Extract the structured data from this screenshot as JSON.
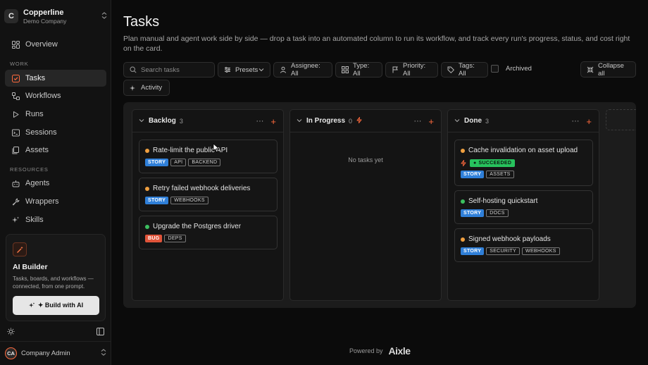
{
  "org": {
    "initial": "C",
    "name": "Copperline",
    "subtitle": "Demo Company"
  },
  "nav": {
    "overview": "Overview",
    "section_work": "WORK",
    "tasks": "Tasks",
    "workflows": "Workflows",
    "runs": "Runs",
    "sessions": "Sessions",
    "assets": "Assets",
    "section_resources": "RESOURCES",
    "agents": "Agents",
    "wrappers": "Wrappers",
    "skills": "Skills"
  },
  "ai_builder": {
    "title": "AI Builder",
    "description": "Tasks, boards, and workflows — connected, from one prompt.",
    "button": "✦ Build with AI"
  },
  "user": {
    "initials": "CA",
    "name": "Company Admin"
  },
  "page": {
    "title": "Tasks",
    "description": "Plan manual and agent work side by side — drop a task into an automated column to run its workflow, and track every run's progress, status, and cost right on the card."
  },
  "toolbar": {
    "search_placeholder": "Search tasks",
    "presets": "Presets",
    "assignee": "Assignee: All",
    "type": "Type: All",
    "priority": "Priority: All",
    "tags": "Tags: All",
    "archived": "Archived",
    "collapse_all": "Collapse all",
    "activity": "Activity"
  },
  "columns": [
    {
      "name": "Backlog",
      "count": "3",
      "cards": [
        {
          "title": "Rate-limit the public API",
          "dot": "#f0a040",
          "tags": [
            "STORY",
            "API",
            "BACKEND"
          ]
        },
        {
          "title": "Retry failed webhook deliveries",
          "dot": "#f0a040",
          "tags": [
            "STORY",
            "WEBHOOKS"
          ]
        },
        {
          "title": "Upgrade the Postgres driver",
          "dot": "#3cc060",
          "tags": [
            "BUG",
            "DEPS"
          ]
        }
      ]
    },
    {
      "name": "In Progress",
      "count": "0",
      "empty": "No tasks yet"
    },
    {
      "name": "Done",
      "count": "3",
      "cards": [
        {
          "title": "Cache invalidation on asset upload",
          "dot": "#f0a040",
          "status": "SUCCEEDED",
          "tags": [
            "STORY",
            "ASSETS"
          ]
        },
        {
          "title": "Self-hosting quickstart",
          "dot": "#3cc060",
          "tags": [
            "STORY",
            "DOCS"
          ]
        },
        {
          "title": "Signed webhook payloads",
          "dot": "#f0a040",
          "tags": [
            "STORY",
            "SECURITY",
            "WEBHOOKS"
          ]
        }
      ]
    }
  ],
  "footer": {
    "powered_by": "Powered by",
    "brand": "Aixle"
  },
  "colors": {
    "accent": "#ff6a3d",
    "story": "#2f7fd8",
    "bug": "#e0543a",
    "success": "#27c25d"
  }
}
